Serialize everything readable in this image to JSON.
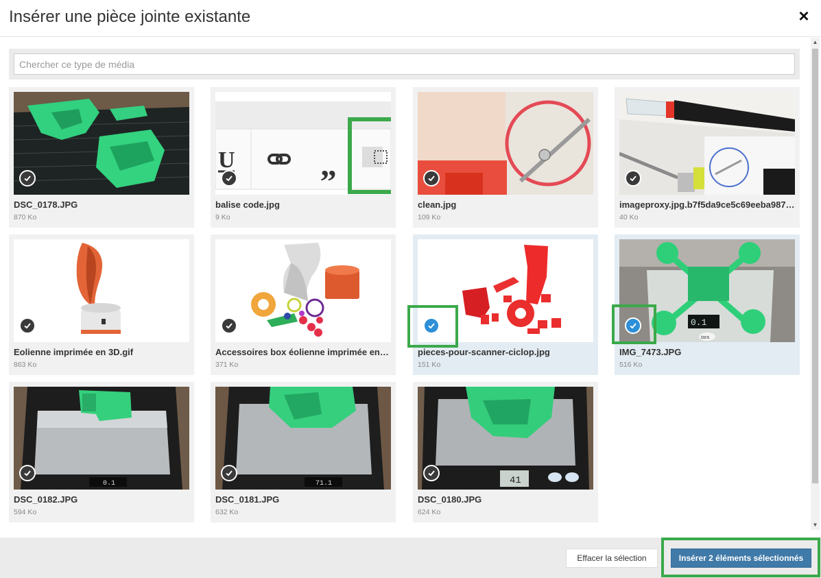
{
  "dialog": {
    "title": "Insérer une pièce jointe existante",
    "close_icon": "×"
  },
  "search": {
    "placeholder": "Chercher ce type de média",
    "value": ""
  },
  "items": [
    {
      "name": "DSC_0178.JPG",
      "size": "870 Ko",
      "selected": false
    },
    {
      "name": "balise code.jpg",
      "size": "9 Ko",
      "selected": false
    },
    {
      "name": "clean.jpg",
      "size": "109 Ko",
      "selected": false
    },
    {
      "name": "imageproxy.jpg.b7f5da9ce5c69eeba987…",
      "size": "40 Ko",
      "selected": false
    },
    {
      "name": "Eolienne imprimée en 3D.gif",
      "size": "863 Ko",
      "selected": false
    },
    {
      "name": "Accessoires box éolienne imprimée en…",
      "size": "371 Ko",
      "selected": false
    },
    {
      "name": "pieces-pour-scanner-ciclop.jpg",
      "size": "151 Ko",
      "selected": true
    },
    {
      "name": "IMG_7473.JPG",
      "size": "516 Ko",
      "selected": true
    },
    {
      "name": "DSC_0182.JPG",
      "size": "594 Ko",
      "selected": false
    },
    {
      "name": "DSC_0181.JPG",
      "size": "632 Ko",
      "selected": false
    },
    {
      "name": "DSC_0180.JPG",
      "size": "624 Ko",
      "selected": false
    }
  ],
  "footer": {
    "clear_label": "Effacer la sélection",
    "insert_label": "Insérer 2 éléments sélectionnés"
  },
  "icons": {
    "check": "check-icon",
    "close": "close-icon",
    "scroll_up": "arrow-up-icon",
    "scroll_down": "arrow-down-icon"
  },
  "thumbnail_text": {
    "balise_glyphs": [
      "U",
      "„"
    ],
    "scale_readouts": [
      "0.1",
      "71.1",
      "41"
    ],
    "scale_brand": "tara"
  },
  "colors": {
    "accent": "#2d8fd8",
    "primary_button": "#407aa8",
    "highlight": "#3ba94a",
    "print_green": "#2fcf7a",
    "print_red": "#e8262a",
    "print_orange": "#d9542b"
  }
}
